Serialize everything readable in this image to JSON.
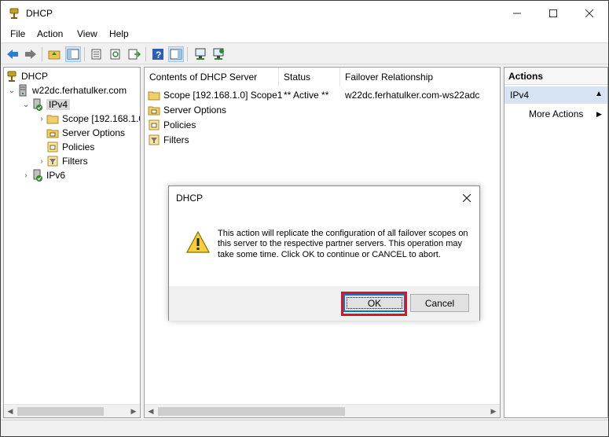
{
  "window": {
    "title": "DHCP"
  },
  "menu": {
    "items": [
      "File",
      "Action",
      "View",
      "Help"
    ]
  },
  "tree": {
    "root": "DHCP",
    "server": "w22dc.ferhatulker.com",
    "ipv4": "IPv4",
    "scope": "Scope [192.168.1.0",
    "server_options": "Server Options",
    "policies": "Policies",
    "filters": "Filters",
    "ipv6": "IPv6"
  },
  "list": {
    "columns": [
      "Contents of DHCP Server",
      "Status",
      "Failover Relationship"
    ],
    "rows": [
      {
        "name": "Scope [192.168.1.0] Scope1",
        "status": "** Active **",
        "failover": "w22dc.ferhatulker.com-ws22adc"
      },
      {
        "name": "Server Options",
        "status": "",
        "failover": ""
      },
      {
        "name": "Policies",
        "status": "",
        "failover": ""
      },
      {
        "name": "Filters",
        "status": "",
        "failover": ""
      }
    ]
  },
  "actions": {
    "header": "Actions",
    "section": "IPv4",
    "more": "More Actions"
  },
  "dialog": {
    "title": "DHCP",
    "message": "This action will replicate the configuration of all failover scopes on this server to the respective partner servers. This operation may take some time. Click OK to continue or CANCEL to abort.",
    "ok": "OK",
    "cancel": "Cancel"
  },
  "colors": {
    "highlight": "#e0141e",
    "focus": "#0078d7",
    "selection": "#d5e3f3"
  }
}
